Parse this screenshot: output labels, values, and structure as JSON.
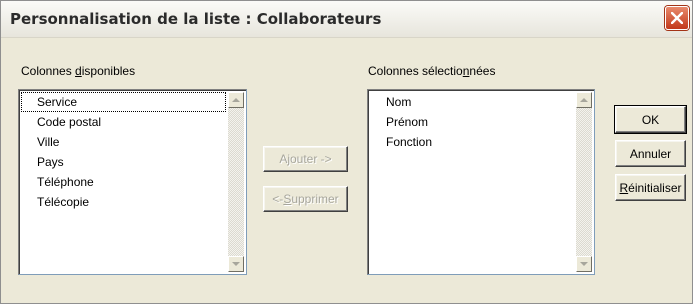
{
  "window": {
    "title": "Personnalisation de la liste : Collaborateurs"
  },
  "available": {
    "label_pre": "Colonnes ",
    "label_mnemonic": "d",
    "label_post": "isponibles",
    "items": [
      "Service",
      "Code postal",
      "Ville",
      "Pays",
      "Téléphone",
      "Télécopie"
    ]
  },
  "selected": {
    "label_pre": "Colonnes sélectio",
    "label_mnemonic": "n",
    "label_post": "nées",
    "items": [
      "Nom",
      "Prénom",
      "Fonction"
    ]
  },
  "actions": {
    "add_label": "Ajouter ->",
    "remove_pre": "<- ",
    "remove_mnemonic": "S",
    "remove_post": "upprimer"
  },
  "buttons": {
    "ok_label": "OK",
    "cancel_label": "Annuler",
    "reset_mnemonic": "R",
    "reset_post": "éinitialiser"
  },
  "colors": {
    "dialog_bg": "#ece9d8",
    "close_button": "#c2381a"
  },
  "icons": {
    "close": "close-x-icon",
    "scroll_up": "triangle-up-icon",
    "scroll_down": "triangle-down-icon"
  }
}
